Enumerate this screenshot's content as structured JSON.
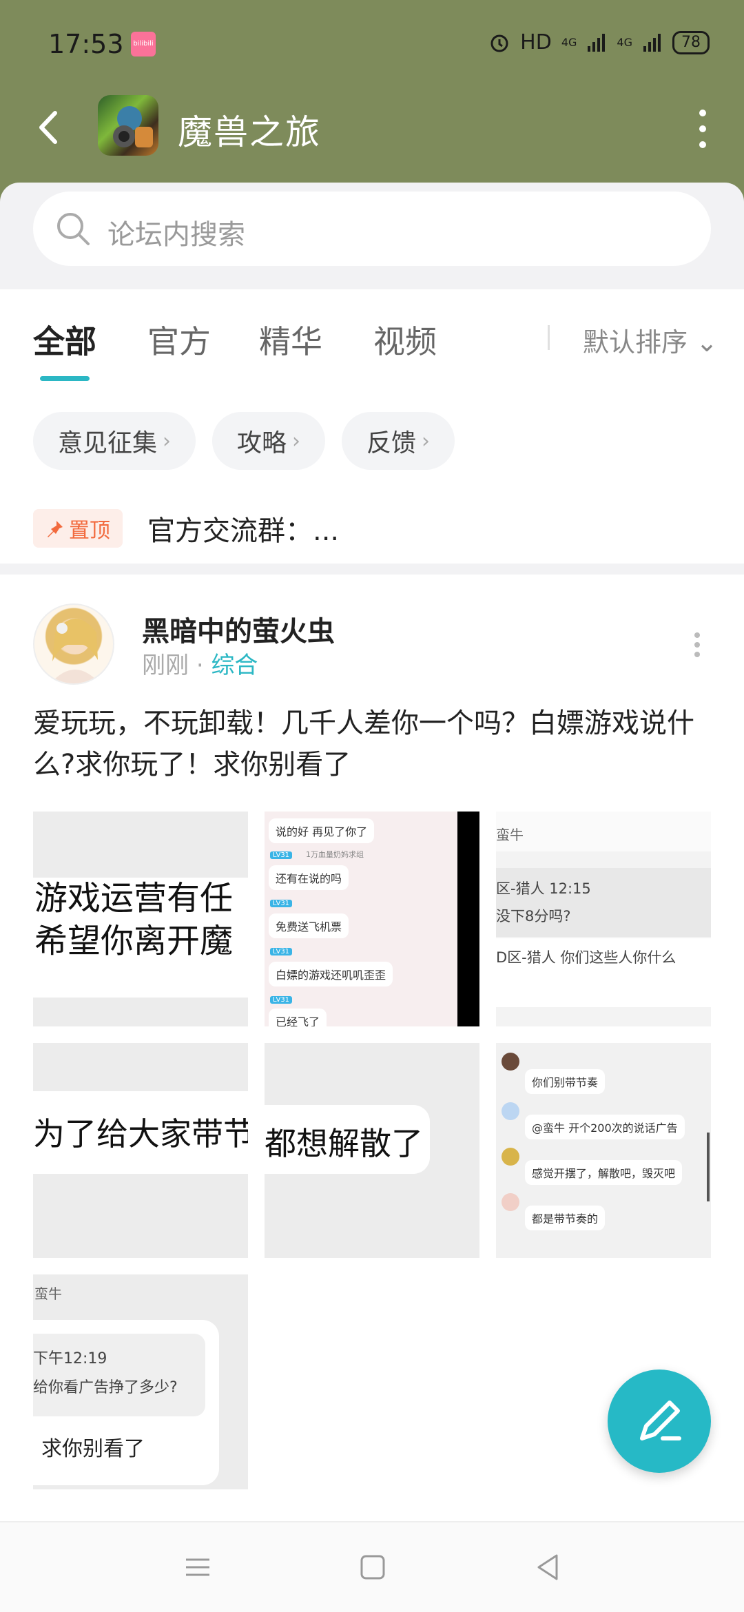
{
  "status_bar": {
    "time": "17:53",
    "app_badge": "bilibili",
    "hd": "HD",
    "network1": "4G",
    "network2": "4G",
    "battery": "78"
  },
  "nav": {
    "title": "魔兽之旅",
    "back_icon": "chevron-left-icon",
    "more_icon": "more-vertical-icon"
  },
  "search": {
    "placeholder": "论坛内搜索"
  },
  "tabs": [
    {
      "label": "全部",
      "active": true
    },
    {
      "label": "官方",
      "active": false
    },
    {
      "label": "精华",
      "active": false
    },
    {
      "label": "视频",
      "active": false
    }
  ],
  "sort": {
    "label": "默认排序 ⌄"
  },
  "chips": [
    {
      "label": "意见征集"
    },
    {
      "label": "攻略"
    },
    {
      "label": "反馈"
    }
  ],
  "pinned": {
    "badge": "置顶",
    "text": "官方交流群：..."
  },
  "post": {
    "author": "黑暗中的萤火虫",
    "time": "刚刚",
    "separator": "·",
    "category": "综合",
    "text": "爱玩玩，不玩卸载！几千人差你一个吗？白嫖游戏说什么?求你玩了！求你别看了",
    "images": {
      "img1": {
        "line1": "游戏运营有任",
        "line2": "希望你离开魔"
      },
      "img2": {
        "msgs": [
          "说的好 再见了你了",
          "还有在说的吗",
          "免费送飞机票",
          "白嫖的游戏还叽叽歪歪",
          "已经飞了"
        ],
        "tag": "1万血量奶妈求组"
      },
      "img3": {
        "name": "蛮牛",
        "line1": "区-猎人 12:15",
        "line2": "没下8分吗?",
        "line3": "D区-猎人 你们这些人你什么"
      },
      "img4": {
        "line1": "为了给大家带节"
      },
      "img5": {
        "line1": "都想解散了"
      },
      "img6": {
        "msgs": [
          "你们别带节奏",
          "@蛮牛 开个200次的说话广告",
          "感觉开摆了，解散吧，毁灭吧",
          "都是带节奏的"
        ]
      },
      "img7": {
        "name": "蛮牛",
        "time": "下午12:19",
        "line1": "给你看广告挣了多少?",
        "line2": "求你别看了"
      }
    }
  },
  "bottom_nav": {
    "menu_icon": "menu-icon",
    "home_icon": "square-home-icon",
    "back_icon": "triangle-back-icon"
  },
  "colors": {
    "header_bg": "#7e8b5b",
    "accent": "#2bb7c4",
    "pin": "#f26a3e"
  }
}
